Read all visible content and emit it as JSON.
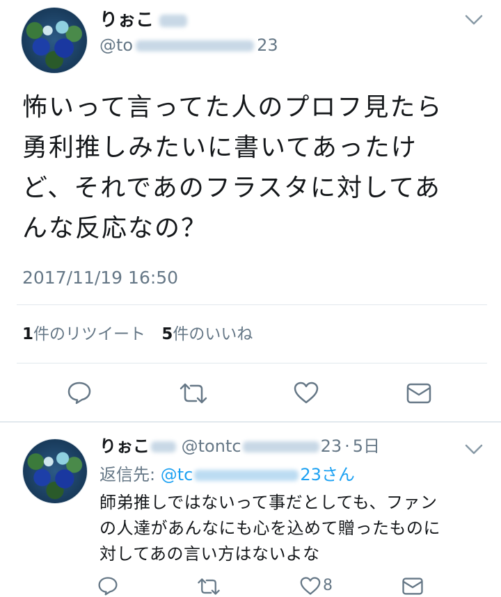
{
  "main_tweet": {
    "display_name": "りぉこ",
    "handle_start": "@to",
    "handle_end": "23",
    "text_lines": [
      "怖いって言ってた人のプロフ見たら",
      "勇利推しみたいに書いてあったけ",
      "ど、それであのフラスタに対してあ",
      "んな反応なの？"
    ],
    "timestamp": "2017/11/19 16:50",
    "retweet_count": "1",
    "retweet_label": "件のリツイート",
    "like_count": "5",
    "like_label": "件のいいね"
  },
  "reply_tweet": {
    "display_name": "りぉこ",
    "handle_start": "@tontc",
    "handle_end": "23",
    "time": "5日",
    "separator": "·",
    "reply_to_label": "返信先:",
    "reply_to_start": "@tc",
    "reply_to_end": "23さん",
    "text_lines": [
      "師弟推しではないって事だとしても、ファン",
      "の人達があんなにも心を込めて贈ったものに",
      "対してあの言い方はないよな"
    ],
    "like_count": "8"
  },
  "icons": {
    "more": "chevron-down-icon",
    "reply": "reply-bubble-icon",
    "retweet": "retweet-icon",
    "like": "heart-icon",
    "dm": "envelope-icon"
  },
  "colors": {
    "text": "#14171a",
    "secondary": "#657786",
    "link": "#1da1f2",
    "divider": "#e1e8ed"
  }
}
